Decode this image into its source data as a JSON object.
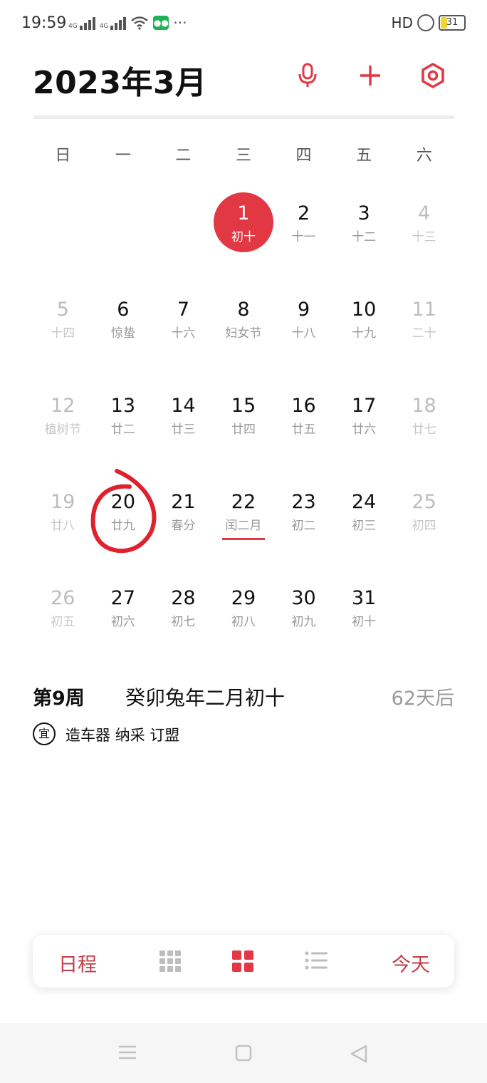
{
  "status_bar": {
    "time": "19:59",
    "network_1": "4G",
    "network_2": "4G",
    "hd_label": "HD",
    "battery": "31"
  },
  "header": {
    "title": "2023年3月",
    "accent_color": "#e13844"
  },
  "weekdays": [
    "日",
    "一",
    "二",
    "三",
    "四",
    "五",
    "六"
  ],
  "calendar": {
    "selected_day": "1",
    "today_underline_day": "22",
    "circled_day": "20",
    "weeks": [
      [
        {
          "day": "",
          "lunar": ""
        },
        {
          "day": "",
          "lunar": ""
        },
        {
          "day": "",
          "lunar": ""
        },
        {
          "day": "1",
          "lunar": "初十"
        },
        {
          "day": "2",
          "lunar": "十一"
        },
        {
          "day": "3",
          "lunar": "十二"
        },
        {
          "day": "4",
          "lunar": "十三"
        }
      ],
      [
        {
          "day": "5",
          "lunar": "十四"
        },
        {
          "day": "6",
          "lunar": "惊蛰"
        },
        {
          "day": "7",
          "lunar": "十六"
        },
        {
          "day": "8",
          "lunar": "妇女节"
        },
        {
          "day": "9",
          "lunar": "十八"
        },
        {
          "day": "10",
          "lunar": "十九"
        },
        {
          "day": "11",
          "lunar": "二十"
        }
      ],
      [
        {
          "day": "12",
          "lunar": "植树节"
        },
        {
          "day": "13",
          "lunar": "廿二"
        },
        {
          "day": "14",
          "lunar": "廿三"
        },
        {
          "day": "15",
          "lunar": "廿四"
        },
        {
          "day": "16",
          "lunar": "廿五"
        },
        {
          "day": "17",
          "lunar": "廿六"
        },
        {
          "day": "18",
          "lunar": "廿七"
        }
      ],
      [
        {
          "day": "19",
          "lunar": "廿八"
        },
        {
          "day": "20",
          "lunar": "廿九"
        },
        {
          "day": "21",
          "lunar": "春分"
        },
        {
          "day": "22",
          "lunar": "闰二月"
        },
        {
          "day": "23",
          "lunar": "初二"
        },
        {
          "day": "24",
          "lunar": "初三"
        },
        {
          "day": "25",
          "lunar": "初四"
        }
      ],
      [
        {
          "day": "26",
          "lunar": "初五"
        },
        {
          "day": "27",
          "lunar": "初六"
        },
        {
          "day": "28",
          "lunar": "初七"
        },
        {
          "day": "29",
          "lunar": "初八"
        },
        {
          "day": "30",
          "lunar": "初九"
        },
        {
          "day": "31",
          "lunar": "初十"
        },
        {
          "day": "",
          "lunar": ""
        }
      ]
    ]
  },
  "info": {
    "week_number": "第9周",
    "lunar_date": "癸卯兔年二月初十",
    "days_later": "62天后",
    "yi_badge": "宜",
    "yi_items": "造车器 纳采 订盟"
  },
  "bottom_bar": {
    "schedule_label": "日程",
    "today_label": "今天"
  },
  "icons": {
    "mic": "microphone-icon",
    "add": "plus-icon",
    "settings": "settings-icon"
  }
}
